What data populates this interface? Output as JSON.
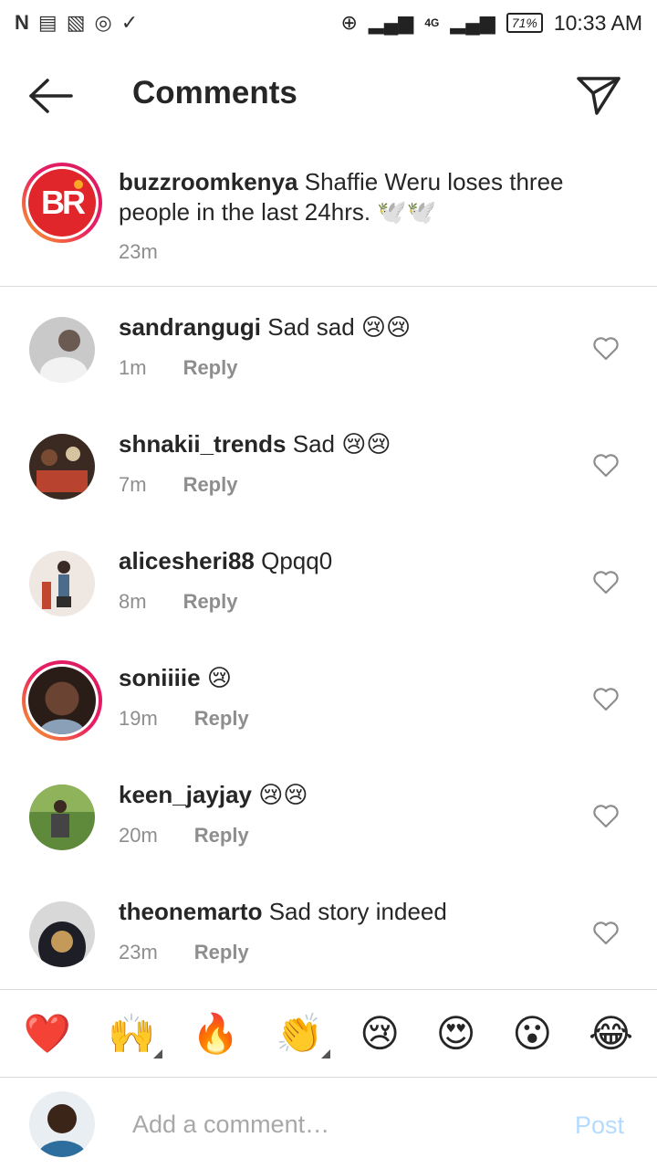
{
  "status_bar": {
    "network_badge": "4G",
    "battery": "71%",
    "time": "10:33 AM"
  },
  "header": {
    "title": "Comments"
  },
  "caption": {
    "username": "buzzroomkenya",
    "text": "Shaffie Weru loses three people in the last 24hrs. 🕊️🕊️",
    "time": "23m",
    "logo_text": "BR"
  },
  "comments": [
    {
      "username": "sandrangugi",
      "text": "Sad sad 😢😢",
      "time": "1m",
      "reply": "Reply"
    },
    {
      "username": "shnakii_trends",
      "text": "Sad 😢😢",
      "time": "7m",
      "reply": "Reply"
    },
    {
      "username": "alicesheri88",
      "text": "Qpqq0",
      "time": "8m",
      "reply": "Reply"
    },
    {
      "username": "soniiiie",
      "text": "😢",
      "time": "19m",
      "reply": "Reply"
    },
    {
      "username": "keen_jayjay",
      "text": "😢😢",
      "time": "20m",
      "reply": "Reply"
    },
    {
      "username": "theonemarto",
      "text": "Sad story indeed",
      "time": "23m",
      "reply": "Reply"
    }
  ],
  "emoji_bar": [
    "❤️",
    "🙌",
    "🔥",
    "👏",
    "😢",
    "😍",
    "😮",
    "😂"
  ],
  "composer": {
    "placeholder": "Add a comment…",
    "post_label": "Post"
  },
  "colors": {
    "text": "#262626",
    "muted": "#8e8e8e",
    "post_disabled": "#b3dbff",
    "divider": "#dbdbdb",
    "brand_red": "#e0262a"
  }
}
